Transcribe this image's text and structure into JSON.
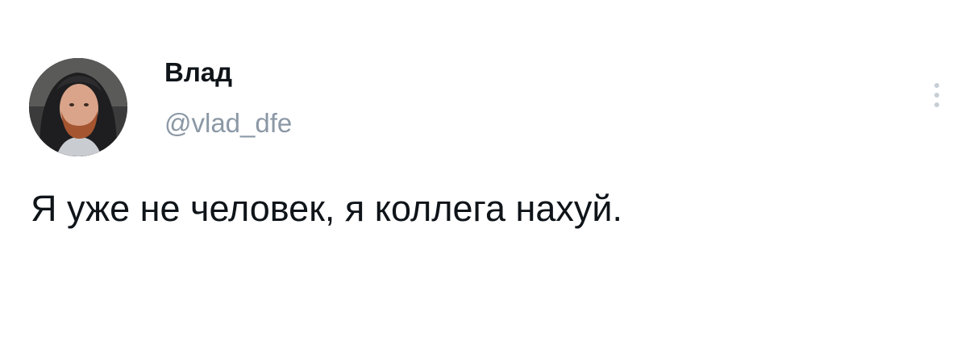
{
  "tweet": {
    "author": {
      "display_name": "Влад",
      "handle": "@vlad_dfe",
      "avatar": "profile-photo"
    },
    "text": "Я уже не человек, я коллега нахуй.",
    "menu_icon": "more-vertical-icon"
  },
  "colors": {
    "background": "#ffffff",
    "text_primary": "#0f1419",
    "text_secondary": "#8b98a5"
  }
}
